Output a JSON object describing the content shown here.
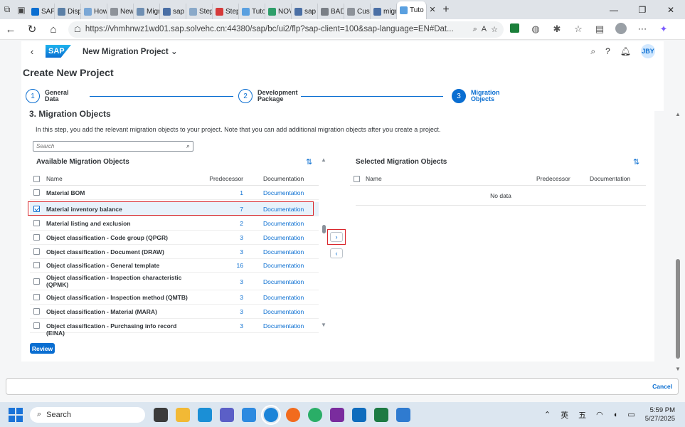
{
  "browser": {
    "tabs": [
      {
        "label": "SAP",
        "color": "#0a6ed1"
      },
      {
        "label": "Displ",
        "color": "#5b7fa6"
      },
      {
        "label": "How",
        "color": "#7aa7d6"
      },
      {
        "label": "New",
        "color": "#8d9299"
      },
      {
        "label": "Migr",
        "color": "#6f8fb3"
      },
      {
        "label": "sap s",
        "color": "#4a6fa5"
      },
      {
        "label": "Step-",
        "color": "#8aa9c9"
      },
      {
        "label": "Step",
        "color": "#d63a3a"
      },
      {
        "label": "Tuto",
        "color": "#5aa0e0"
      },
      {
        "label": "NOV",
        "color": "#2e9e6a"
      },
      {
        "label": "sap r",
        "color": "#4a6fa5"
      },
      {
        "label": "BADI",
        "color": "#7a7f86"
      },
      {
        "label": "Cust",
        "color": "#8d9299"
      },
      {
        "label": "migr",
        "color": "#4a6fa5"
      },
      {
        "label": "Tuto",
        "color": "#5aa0e0"
      }
    ],
    "url": "https://vhmhnwz1wd01.sap.solvehc.cn:44380/sap/bc/ui2/flp?sap-client=100&sap-language=EN#Dat..."
  },
  "shell": {
    "title": "New Migration Project",
    "logo_text": "SAP",
    "user_initials": "JBY"
  },
  "page": {
    "title": "Create New Project",
    "steps": [
      {
        "number": "1",
        "line1": "General",
        "line2": "Data"
      },
      {
        "number": "2",
        "line1": "Development",
        "line2": "Package"
      },
      {
        "number": "3",
        "line1": "Migration",
        "line2": "Objects"
      }
    ]
  },
  "section": {
    "title": "3. Migration Objects",
    "intro": "In this step, you add the relevant migration objects to your project. Note that you can add additional migration objects after you create a project.",
    "search_placeholder": "Search"
  },
  "available": {
    "title": "Available Migration Objects",
    "columns": {
      "name": "Name",
      "predecessor": "Predecessor",
      "documentation": "Documentation"
    },
    "rows": [
      {
        "name": "Material BOM",
        "predecessor": "1",
        "documentation": "Documentation"
      },
      {
        "name": "Material inventory balance",
        "predecessor": "7",
        "documentation": "Documentation"
      },
      {
        "name": "Material listing and exclusion",
        "predecessor": "2",
        "documentation": "Documentation"
      },
      {
        "name": "Object classification - Code group (QPGR)",
        "predecessor": "3",
        "documentation": "Documentation"
      },
      {
        "name": "Object classification - Document (DRAW)",
        "predecessor": "3",
        "documentation": "Documentation"
      },
      {
        "name": "Object classification - General template",
        "predecessor": "16",
        "documentation": "Documentation"
      },
      {
        "name": "Object classification - Inspection characteristic (QPMK)",
        "predecessor": "3",
        "documentation": "Documentation"
      },
      {
        "name": "Object classification - Inspection method (QMTB)",
        "predecessor": "3",
        "documentation": "Documentation"
      },
      {
        "name": "Object classification - Material (MARA)",
        "predecessor": "3",
        "documentation": "Documentation"
      },
      {
        "name": "Object classification - Purchasing info record (EINA)",
        "predecessor": "3",
        "documentation": "Documentation"
      }
    ]
  },
  "selected": {
    "title": "Selected Migration Objects",
    "columns": {
      "name": "Name",
      "predecessor": "Predecessor",
      "documentation": "Documentation"
    },
    "empty_text": "No data"
  },
  "actions": {
    "review": "Review",
    "cancel": "Cancel",
    "move_right": "›",
    "move_left": "‹"
  },
  "taskbar": {
    "search_label": "Search",
    "ime_1": "英",
    "ime_2": "五",
    "time": "5:59 PM",
    "date": "5/27/2025"
  },
  "colors": {
    "accent": "#0a6ed1",
    "highlight": "#d9262c"
  }
}
